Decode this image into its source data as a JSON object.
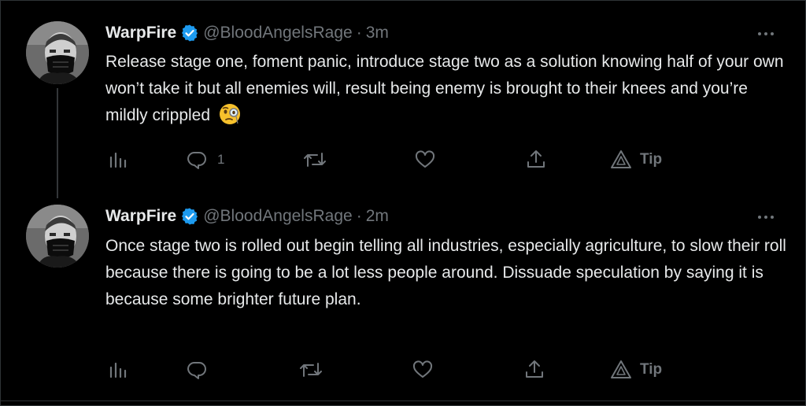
{
  "colors": {
    "background": "#000000",
    "text_primary": "#e7e9ea",
    "text_secondary": "#71767b",
    "verified": "#1d9bf0",
    "divider": "#2f3336"
  },
  "tweets": [
    {
      "display_name": "WarpFire",
      "handle": "@BloodAngelsRage",
      "separator": "·",
      "time": "3m",
      "text": "Release stage one, foment panic, introduce stage two as a solution knowing half of your own won’t take it but all enemies will, result being enemy is brought to their knees and you’re mildly crippled",
      "emoji": "face-with-monocle",
      "reply_count": "1",
      "tip_label": "Tip"
    },
    {
      "display_name": "WarpFire",
      "handle": "@BloodAngelsRage",
      "separator": "·",
      "time": "2m",
      "text": "Once stage two is rolled out begin telling all industries, especially agriculture, to slow their roll because there is going to be a lot less people around. Dissuade speculation by saying it is because some brighter future plan.",
      "reply_count": "",
      "tip_label": "Tip"
    }
  ],
  "icons": {
    "views": "analytics-icon",
    "reply": "reply-icon",
    "retweet": "retweet-icon",
    "like": "heart-icon",
    "share": "share-icon",
    "tip": "tip-icon",
    "more": "more-icon",
    "verified": "verified-badge-icon"
  }
}
